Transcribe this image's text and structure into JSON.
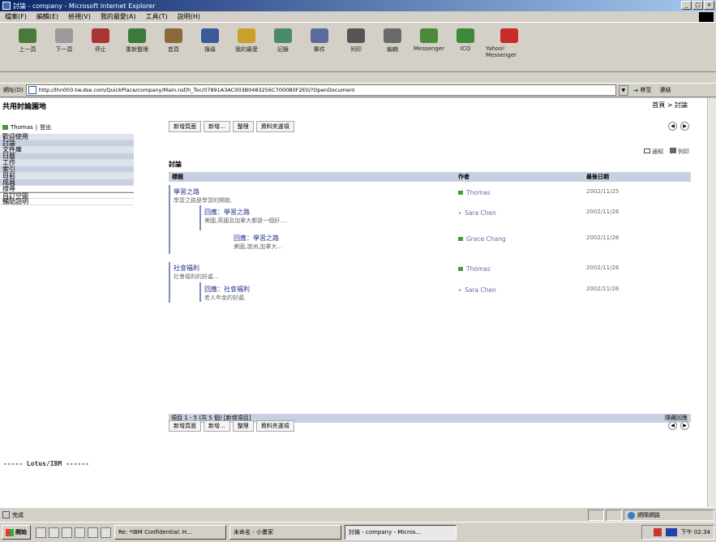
{
  "window": {
    "title": "討論 - company - Microsoft Internet Explorer"
  },
  "menu": [
    "檔案(F)",
    "編輯(E)",
    "檢視(V)",
    "我的最愛(A)",
    "工具(T)",
    "說明(H)"
  ],
  "toolbar": [
    {
      "label": "上一頁",
      "icon": "back-arrow-icon",
      "color": "#4a7a3a"
    },
    {
      "label": "下一頁",
      "icon": "forward-arrow-icon",
      "color": "#9a9a9a"
    },
    {
      "label": "停止",
      "icon": "stop-icon",
      "color": "#a33"
    },
    {
      "label": "重新整理",
      "icon": "refresh-icon",
      "color": "#3a7a3a"
    },
    {
      "label": "首頁",
      "icon": "home-icon",
      "color": "#8a6a3a"
    },
    {
      "label": "搜尋",
      "icon": "search-icon",
      "color": "#3a5a9a"
    },
    {
      "label": "我的最愛",
      "icon": "favorites-icon",
      "color": "#c9a02a"
    },
    {
      "label": "記錄",
      "icon": "history-icon",
      "color": "#4a8a6a"
    },
    {
      "label": "郵件",
      "icon": "mail-icon",
      "color": "#5a6a9a"
    },
    {
      "label": "列印",
      "icon": "print-icon",
      "color": "#555"
    },
    {
      "label": "編輯",
      "icon": "edit-icon",
      "color": "#6a6a6a"
    },
    {
      "label": "Messenger",
      "icon": "messenger-icon",
      "color": "#4a8a3a"
    },
    {
      "label": "ICQ",
      "icon": "icq-icon",
      "color": "#3a8a3a"
    },
    {
      "label": "Yahoo! Messenger",
      "icon": "yahoo-messenger-icon",
      "color": "#c92a2a"
    }
  ],
  "address": {
    "label": "網址(D)",
    "url": "http://lhn003-tw.dse.com/QuickPlace/company/Main.nsf/h_Toc/07891A3AC003B0483256C7000B0F2E0/?OpenDocument",
    "go": "移至",
    "links": "連結"
  },
  "site": {
    "title": "共用討論園地",
    "top_links": "首頁 > 討論"
  },
  "user": {
    "name": "Thomas",
    "action": "登出"
  },
  "sidebar": [
    {
      "label": "歡迎使用",
      "style": "a"
    },
    {
      "label": "討論",
      "style": "b"
    },
    {
      "label": "文件庫",
      "style": "a"
    },
    {
      "label": "日曆",
      "style": "b"
    },
    {
      "label": "工作",
      "style": "a"
    },
    {
      "label": "索引",
      "style": "b"
    },
    {
      "label": "目前",
      "style": "a"
    },
    {
      "label": "成員",
      "style": "b"
    },
    {
      "label": "搜尋",
      "style": "w"
    },
    {
      "label": "自訂空間",
      "style": "w2"
    },
    {
      "label": "輔助說明",
      "style": "w"
    }
  ],
  "buttons": [
    "新增頁面",
    "新增...",
    "整理",
    "資料夾選項"
  ],
  "actions": {
    "notify": "通知",
    "print": "列印"
  },
  "discussion": {
    "title": "討論",
    "headers": {
      "topic": "標題",
      "author": "作者",
      "date": "最後日期"
    },
    "rows": [
      {
        "topic": "學習之路",
        "excerpt": "學習之路是學習的開始.",
        "author": "Thomas",
        "date": "2002/11/25",
        "badge": "green"
      },
      {
        "topic": "回應：學習之路",
        "excerpt": "美國,英國及加拿大都是一個好....",
        "author": "Sara Chen",
        "date": "2002/11/26",
        "badge": "dot"
      },
      {
        "topic": "回應：學習之路",
        "excerpt": "美國,澳洲,加拿大...",
        "author": "Grace Chang",
        "date": "2002/11/26",
        "badge": "green"
      },
      {
        "topic": "社會福利",
        "excerpt": "社會福利的好處...",
        "author": "Thomas",
        "date": "2002/11/26",
        "badge": "green"
      },
      {
        "topic": "回應：社會福利",
        "excerpt": "老人年金的好處.",
        "author": "Sara Chen",
        "date": "2002/11/26",
        "badge": "dot"
      }
    ],
    "footer": "項目 1 - 5 (共 5 個)  [新增項目]",
    "footer_right": "隱藏回應"
  },
  "lotus": "----- Lotus/IBM ------",
  "status": {
    "text": "完成",
    "zone": "網際網路"
  },
  "taskbar": {
    "start": "開始",
    "tasks": [
      "Re: *IBM Confidential: H...",
      "未命名 - 小畫家",
      "討論 - company - Micros..."
    ],
    "clock": "下午 02:34"
  }
}
